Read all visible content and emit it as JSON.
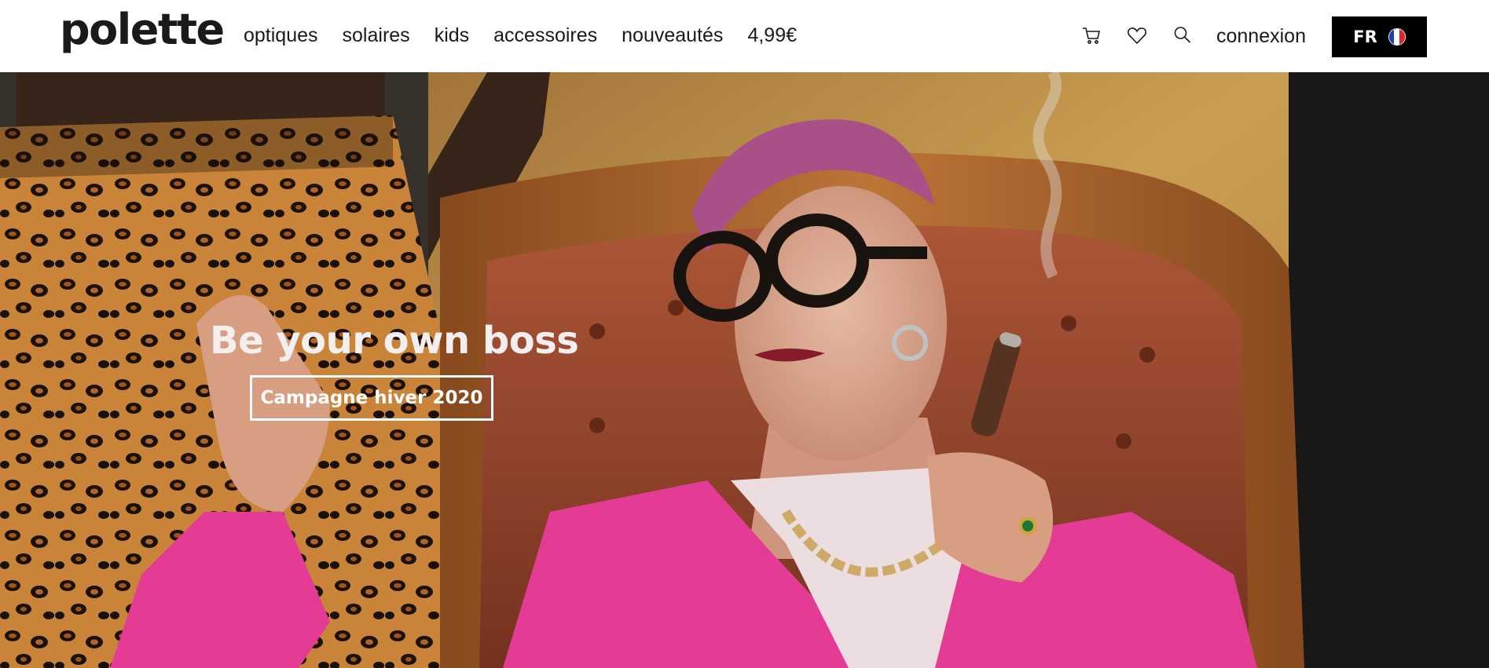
{
  "brand": {
    "logo_text": "polette"
  },
  "nav": {
    "items": [
      {
        "label": "optiques"
      },
      {
        "label": "solaires"
      },
      {
        "label": "kids"
      },
      {
        "label": "accessoires"
      },
      {
        "label": "nouveautés"
      },
      {
        "label": "4,99€"
      }
    ]
  },
  "actions": {
    "cart_icon": "cart-icon",
    "wishlist_icon": "heart-icon",
    "search_icon": "search-icon",
    "login_label": "connexion",
    "language": {
      "label": "FR",
      "flag_icon": "france-flag-icon"
    }
  },
  "hero": {
    "title": "Be your own boss",
    "cta_label": "Campagne hiver 2020"
  },
  "colors": {
    "header_bg": "#ffffff",
    "text": "#1a1a1a",
    "lang_button_bg": "#000000",
    "blazer_pink": "#ee3f9c",
    "hair_purple": "#b0548f",
    "backdrop_ochre": "#c99a4a"
  }
}
